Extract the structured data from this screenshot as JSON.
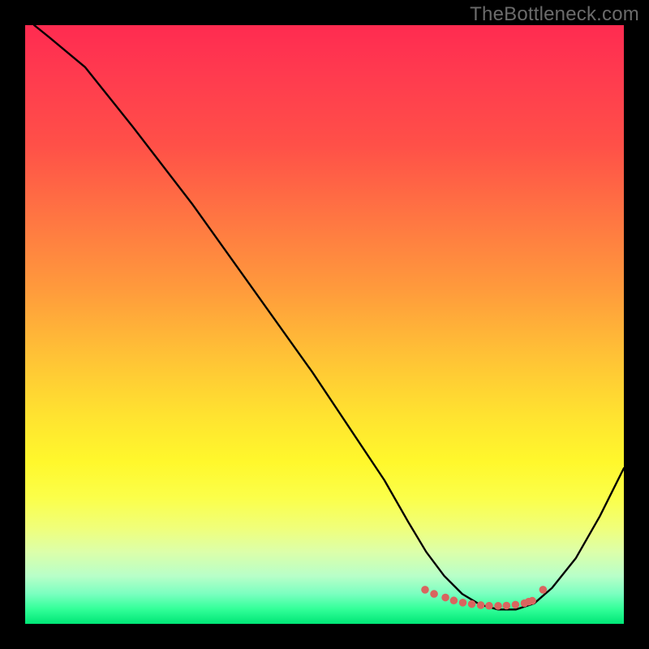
{
  "watermark": "TheBottleneck.com",
  "chart_data": {
    "type": "line",
    "title": "",
    "xlabel": "",
    "ylabel": "",
    "xlim": [
      0,
      100
    ],
    "ylim": [
      0,
      100
    ],
    "grid": false,
    "series": [
      {
        "name": "curve",
        "x": [
          1.5,
          4,
          10,
          18,
          28,
          38,
          48,
          55,
          60,
          64,
          67,
          70,
          73,
          76,
          79,
          82,
          85,
          88,
          92,
          96,
          100
        ],
        "y": [
          100,
          98,
          93,
          83,
          70,
          56,
          42,
          31.5,
          24,
          17,
          12,
          8,
          5,
          3.2,
          2.4,
          2.4,
          3.4,
          6,
          11,
          18,
          26
        ]
      }
    ],
    "markers": {
      "name": "trough-points",
      "color": "#d9655f",
      "x": [
        66.8,
        68.3,
        70.2,
        71.6,
        73.1,
        74.6,
        76.1,
        77.5,
        79.0,
        80.4,
        81.9,
        83.4,
        84.1,
        84.7,
        86.5
      ],
      "y": [
        5.7,
        5.0,
        4.4,
        3.9,
        3.55,
        3.3,
        3.12,
        3.02,
        3.0,
        3.05,
        3.2,
        3.45,
        3.7,
        3.85,
        5.7
      ]
    }
  }
}
